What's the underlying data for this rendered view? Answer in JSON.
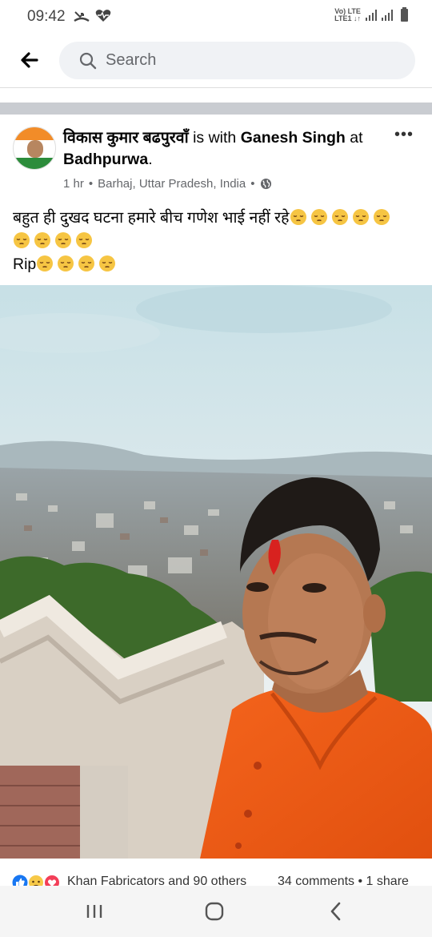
{
  "status_bar": {
    "time": "09:42",
    "network_top": "Vo) LTE",
    "network_bottom": "LTE1 ↓↑",
    "icons": [
      "missed-call-icon",
      "heart-pulse-icon",
      "signal-icon",
      "battery-icon"
    ]
  },
  "header": {
    "search_placeholder": "Search",
    "back_icon": "back-arrow-icon",
    "search_icon": "search-icon"
  },
  "post": {
    "author": "विकास कुमार बढपुरवाँ",
    "with_text": "is with",
    "tagged": "Ganesh Singh",
    "at_text": "at",
    "location_tag": "Badhpurwa",
    "period": ".",
    "time": "1 hr",
    "location": "Barhaj, Uttar Pradesh, India",
    "privacy_icon": "globe-icon",
    "more_icon": "more-dots-icon",
    "more_label": "•••",
    "text_line1": "बहुत ही दुखद घटना हमारे बीच गणेश भाई नहीं  रहे",
    "text_rip": "Rip",
    "emoji_icon": "pensive-face-icon"
  },
  "reactions": {
    "icons": [
      "like-icon",
      "sad-icon",
      "love-icon"
    ],
    "names": "Khan Fabricators and 90 others",
    "comments": "34 comments",
    "shares": "1 share"
  },
  "nav_bar": {
    "icons": [
      "recent-apps-icon",
      "home-icon",
      "back-icon"
    ]
  }
}
